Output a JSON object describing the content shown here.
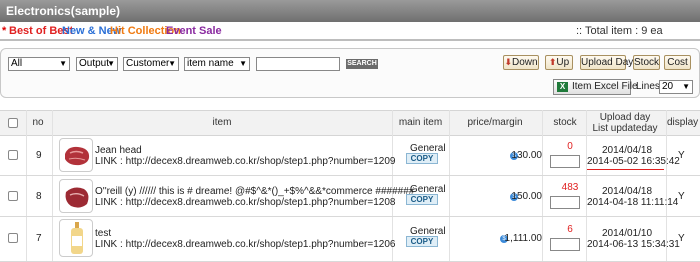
{
  "header": {
    "title": "Electronics(sample)"
  },
  "categories": {
    "star": "*",
    "items": [
      "Best of Best",
      "New & New",
      "Hit Collection",
      "Event Sale"
    ],
    "total": ":: Total item : 9 ea"
  },
  "filters": {
    "select1": "All",
    "select2": "Output",
    "select3": "Customer",
    "select4": "item name",
    "search_value": "",
    "search_label": "SEARCH"
  },
  "buttons": {
    "down": "Down",
    "up": "Up",
    "upload_day": "Upload Day",
    "stock": "Stock",
    "cost": "Cost"
  },
  "excel": {
    "icon": "X",
    "label": "Item Excel File"
  },
  "lines": {
    "label": "Lines",
    "value": "20"
  },
  "table": {
    "headers": {
      "no": "no",
      "item": "item",
      "main_item": "main item",
      "price_margin": "price/margin",
      "stock": "stock",
      "upload_day": "Upload day",
      "list_update": "List updateday",
      "display": "display"
    },
    "rows": [
      {
        "no": "9",
        "name": "Jean head",
        "link": "LINK : http://decex8.dreamweb.co.kr/shop/step1.php?number=1209",
        "main": "General",
        "copy": "COPY",
        "price": "130.00",
        "stock": "0",
        "upload": "2014/04/18",
        "updated": "2014-05-02 16:35:42",
        "display": "Y"
      },
      {
        "no": "8",
        "name": "O''reill (y) ////// this is # dreame! @#$^&*()_+$%^&&*commerce #######",
        "link": "LINK : http://decex8.dreamweb.co.kr/shop/step1.php?number=1208",
        "main": "General",
        "copy": "COPY",
        "price": "150.00",
        "stock": "483",
        "upload": "2014/04/18",
        "updated": "2014-04-18 11:11:14",
        "display": "Y"
      },
      {
        "no": "7",
        "name": "test",
        "link": "LINK : http://decex8.dreamweb.co.kr/shop/step1.php?number=1206",
        "main": "General",
        "copy": "COPY",
        "price": "1,111.00",
        "stock": "6",
        "upload": "2014/01/10",
        "updated": "2014-06-13 15:34:31",
        "display": "Y"
      }
    ]
  }
}
